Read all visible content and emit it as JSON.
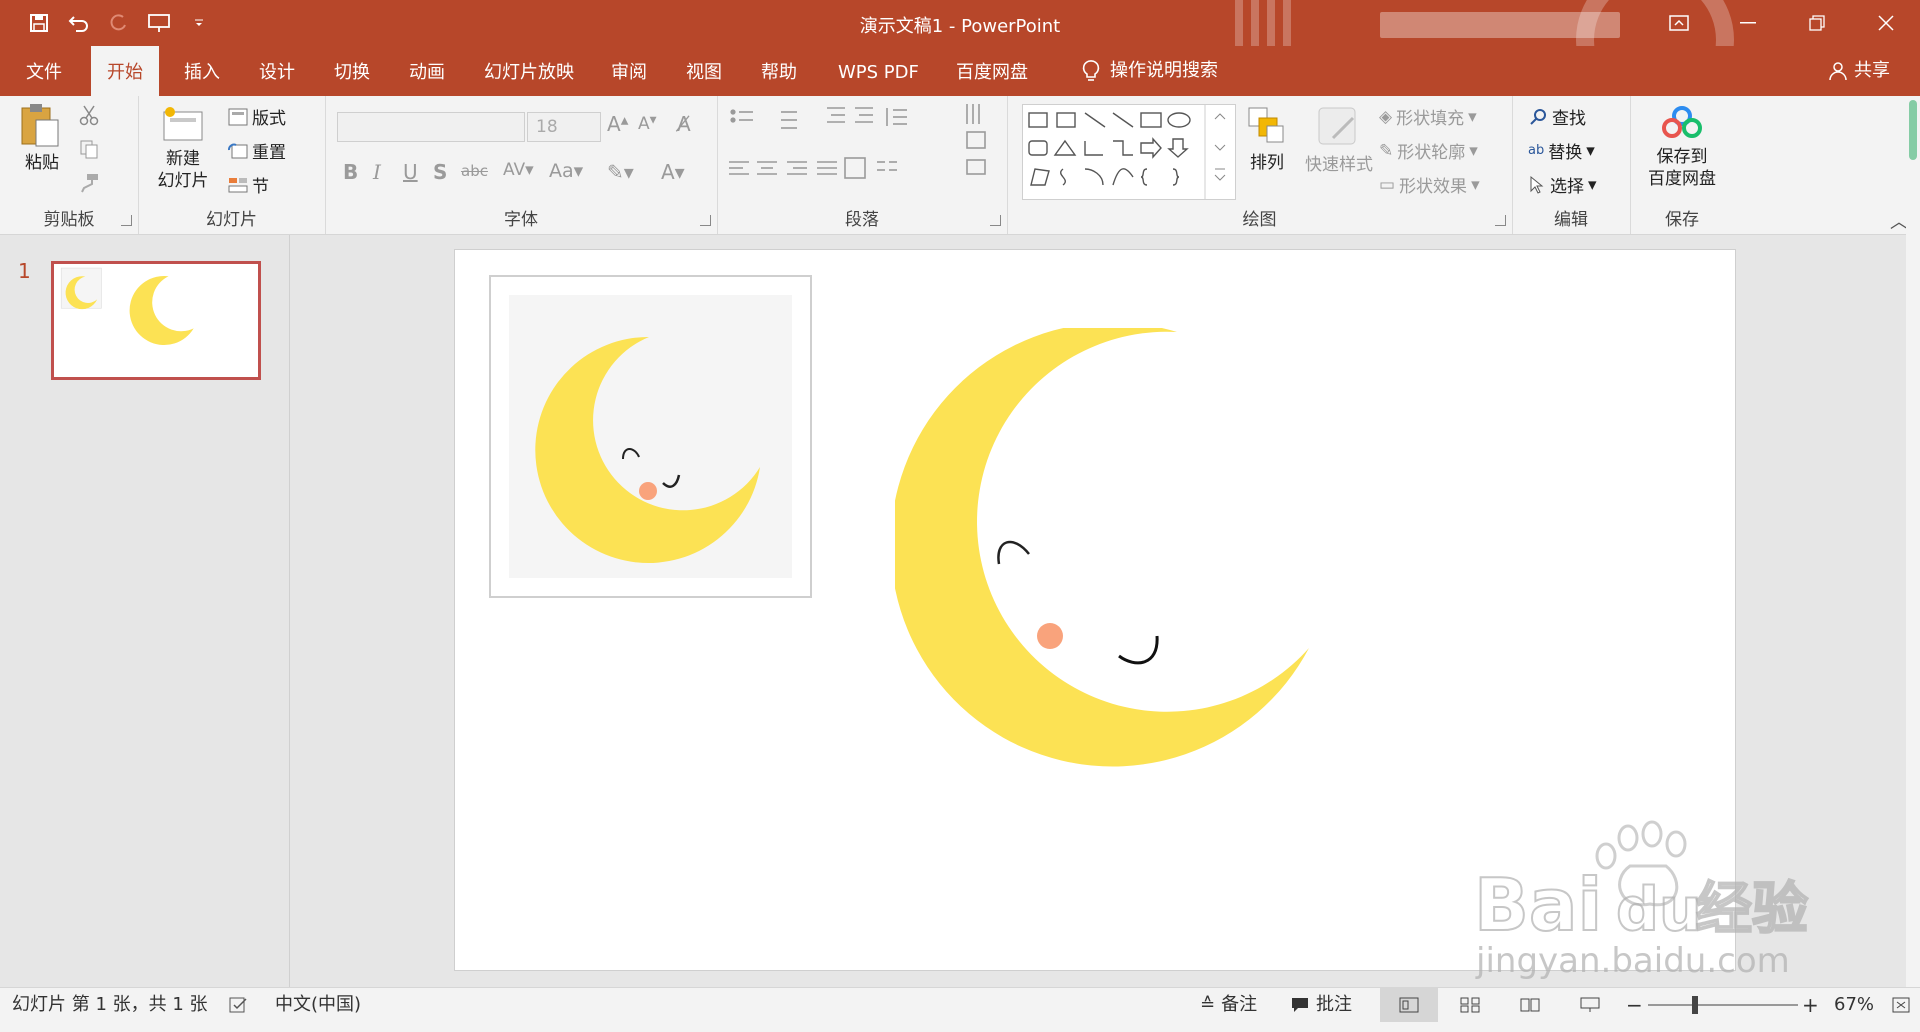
{
  "titlebar": {
    "title": "演示文稿1  -  PowerPoint",
    "accent": "#b7472a"
  },
  "tabs": [
    "文件",
    "开始",
    "插入",
    "设计",
    "切换",
    "动画",
    "幻灯片放映",
    "审阅",
    "视图",
    "帮助",
    "WPS PDF",
    "百度网盘",
    "操作说明搜索"
  ],
  "active_tab": "开始",
  "share_label": "共享",
  "ribbon": {
    "clipboard": {
      "paste": "粘贴",
      "label": "剪贴板"
    },
    "slides": {
      "new_slide_line1": "新建",
      "new_slide_line2": "幻灯片",
      "layout": "版式",
      "reset": "重置",
      "section": "节",
      "label": "幻灯片"
    },
    "font": {
      "size": "18",
      "label": "字体"
    },
    "paragraph": {
      "label": "段落"
    },
    "drawing": {
      "arrange": "排列",
      "quick_styles": "快速样式",
      "fill": "形状填充",
      "outline": "形状轮廓",
      "effects": "形状效果",
      "label": "绘图"
    },
    "editing": {
      "find": "查找",
      "replace": "替换",
      "select": "选择",
      "label": "编辑"
    },
    "save": {
      "line1": "保存到",
      "line2": "百度网盘",
      "label": "保存"
    }
  },
  "slide_panel": {
    "number": "1"
  },
  "status": {
    "slide_info": "幻灯片 第 1 张，共 1 张",
    "language": "中文(中国)",
    "notes": "备注",
    "comments": "批注",
    "zoom": "67%"
  },
  "watermark": {
    "brand": "Bai",
    "brand2": "du",
    "jingyan": "经验",
    "url": "jingyan.baidu.com"
  },
  "colors": {
    "moon": "#fce254",
    "blush": "#f9a37c",
    "photo_bg": "#f5f5f5"
  }
}
